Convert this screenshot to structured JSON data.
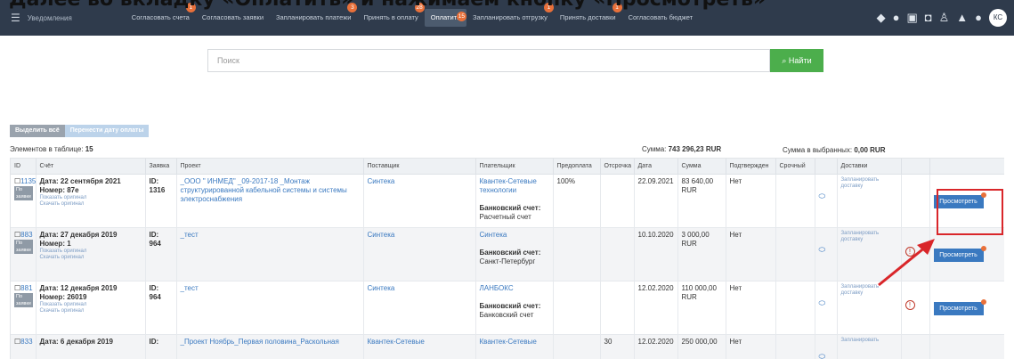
{
  "caption": "Далее во вкладку «Оплатить» и нажимаем кнопку «Просмотреть»",
  "topbar": {
    "menu_icon": "hamburger-icon",
    "notifications": "Уведомления",
    "tabs": [
      {
        "label": "Согласовать счета",
        "badge": "1"
      },
      {
        "label": "Согласовать заявки",
        "badge": ""
      },
      {
        "label": "Запланировать платежи",
        "badge": "3"
      },
      {
        "label": "Принять в оплату",
        "badge": "28"
      },
      {
        "label": "Оплатить",
        "badge": "15",
        "active": true
      },
      {
        "label": "Запланировать отгрузку",
        "badge": "1"
      },
      {
        "label": "Принять доставки",
        "badge": "1"
      },
      {
        "label": "Согласовать бюджет",
        "badge": ""
      }
    ],
    "user_initials": "КС"
  },
  "search": {
    "placeholder": "Поиск",
    "button": "Найти"
  },
  "toolbar": {
    "select_all": "Выделить всё",
    "move_date": "Перенести дату оплаты"
  },
  "summary": {
    "count_label": "Элементов в таблице:",
    "count": "15",
    "sum_label": "Сумма:",
    "sum": "743 296,23 RUR",
    "selected_label": "Сумма в выбранных:",
    "selected": "0,00 RUR"
  },
  "columns": [
    "ID",
    "Счёт",
    "Заявка",
    "Проект",
    "Поставщик",
    "Плательщик",
    "Предоплата",
    "Отсрочка",
    "Дата",
    "Сумма",
    "Подтвержден",
    "Срочный",
    "",
    "Доставки",
    "",
    ""
  ],
  "rows": [
    {
      "id": "1135",
      "tag": "По заявке",
      "invoice": "Дата: 22 сентября 2021 Номер: 87е",
      "links": [
        "Показать оригинал",
        "Скачать оригинал"
      ],
      "request": "ID: 1316",
      "project": "_ООО \" ИНМЕД\" _09-2017-18 _Монтаж структурированной кабельной системы и системы электроснабжения",
      "supplier": "Синтека",
      "payer": "Квантек-Сетевые технологии",
      "bank_label": "Банковский счет:",
      "bank": "Расчетный счет",
      "prepay": "100%",
      "delay": "",
      "date": "22.09.2021",
      "amount": "83 640,00 RUR",
      "confirmed": "Нет",
      "delivery": "Запланировать доставку",
      "warn": false,
      "button": "Просмотреть"
    },
    {
      "id": "883",
      "tag": "По заявке",
      "invoice": "Дата: 27 декабря 2019 Номер: 1",
      "links": [
        "Показать оригинал",
        "Скачать оригинал"
      ],
      "request": "ID: 964",
      "project": "_тест",
      "supplier": "Синтека",
      "payer": "Синтека",
      "bank_label": "Банковский счет:",
      "bank": "Санкт-Петербург",
      "prepay": "",
      "delay": "",
      "date": "10.10.2020",
      "amount": "3 000,00 RUR",
      "confirmed": "Нет",
      "delivery": "Запланировать доставку",
      "warn": true,
      "button": "Просмотреть"
    },
    {
      "id": "881",
      "tag": "По заявке",
      "invoice": "Дата: 12 декабря 2019 Номер: 26019",
      "links": [
        "Показать оригинал",
        "Скачать оригинал"
      ],
      "request": "ID: 964",
      "project": "_тест",
      "supplier": "Синтека",
      "payer": "ЛАНБОКС",
      "bank_label": "Банковский счет:",
      "bank": "Банковский счет",
      "prepay": "",
      "delay": "",
      "date": "12.02.2020",
      "amount": "110 000,00 RUR",
      "confirmed": "Нет",
      "delivery": "Запланировать доставку",
      "warn": true,
      "button": "Просмотреть"
    },
    {
      "id": "833",
      "tag": "",
      "invoice": "Дата: 6 декабря 2019",
      "links": [],
      "request": "ID:",
      "project": "_Проект Ноябрь_Первая половина_Раскольная",
      "supplier": "Квантек-Сетевые",
      "payer": "Квантек-Сетевые",
      "bank_label": "",
      "bank": "",
      "prepay": "",
      "delay": "30",
      "date": "12.02.2020",
      "amount": "250 000,00",
      "confirmed": "Нет",
      "delivery": "Запланировать",
      "warn": false,
      "button": ""
    }
  ]
}
